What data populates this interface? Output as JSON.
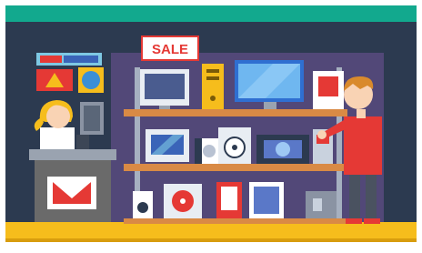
{
  "scene": {
    "sale_sign": {
      "label": "SALE"
    },
    "colors": {
      "top_bar": "#12a98e",
      "wall": "#2c3a50",
      "shop_panel": "#524878",
      "floor": "#f6bd1c",
      "shelf": "#d98a45",
      "sale_red": "#e53935",
      "counter": "#6a6a6a",
      "customer_shirt": "#e53935",
      "cashier_hair": "#f6bd1c"
    },
    "icons": [
      "sale-sign",
      "monitor-icon",
      "pc-tower-icon",
      "printer-icon",
      "speaker-icon",
      "hard-drive-icon",
      "phone-icon",
      "camera-icon",
      "envelope-logo-icon"
    ]
  }
}
